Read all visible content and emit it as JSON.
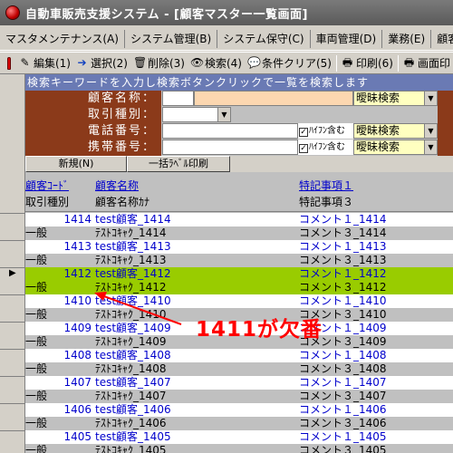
{
  "window": {
    "title": "自動車販売支援システム - [顧客マスター一覧画面]"
  },
  "menubar": {
    "items": [
      "マスタメンテナンス(A)",
      "システム管理(B)",
      "システム保守(C)",
      "車両管理(D)",
      "業務(E)",
      "顧客取引履"
    ]
  },
  "toolbar": {
    "edit": "編集(1)",
    "select": "選択(2)",
    "delete": "削除(3)",
    "search": "検索(4)",
    "clear": "条件クリア(5)",
    "print": "印刷(6)",
    "screen_print": "画面印"
  },
  "search": {
    "hint": "検索キーワードを入力し検索ボタンクリックで一覧を検索します",
    "customer_name_label": "顧客名称：",
    "trade_type_label": "取引種別：",
    "phone_label": "電話番号：",
    "mobile_label": "携帯番号：",
    "hyphen_label": "ﾊｲﾌﾝ含む",
    "fuzzy_label": "曖昧検索"
  },
  "buttons": {
    "new": "新規(N)",
    "bulk_label_print": "一括ﾗﾍﾞﾙ印刷"
  },
  "grid": {
    "headers": {
      "customer_code": "顧客ｺｰﾄﾞ",
      "customer_name": "顧客名称",
      "special1": "特記事項１",
      "trade_type": "取引種別",
      "customer_kana": "顧客名称ｶﾅ",
      "special3": "特記事項３"
    },
    "records": [
      {
        "code": "1414",
        "name": "test顧客_1414",
        "note1": "コメント１_1414",
        "type": "一般",
        "kana": "ﾃｽﾄｺｷｬｸ_1414",
        "note3": "コメント３_1414"
      },
      {
        "code": "1413",
        "name": "test顧客_1413",
        "note1": "コメント１_1413",
        "type": "一般",
        "kana": "ﾃｽﾄｺｷｬｸ_1413",
        "note3": "コメント３_1413"
      },
      {
        "code": "1412",
        "name": "test顧客_1412",
        "note1": "コメント１_1412",
        "type": "一般",
        "kana": "ﾃｽﾄｺｷｬｸ_1412",
        "note3": "コメント３_1412"
      },
      {
        "code": "1410",
        "name": "test顧客_1410",
        "note1": "コメント１_1410",
        "type": "一般",
        "kana": "ﾃｽﾄｺｷｬｸ_1410",
        "note3": "コメント３_1410"
      },
      {
        "code": "1409",
        "name": "test顧客_1409",
        "note1": "コメント１_1409",
        "type": "一般",
        "kana": "ﾃｽﾄｺｷｬｸ_1409",
        "note3": "コメント３_1409"
      },
      {
        "code": "1408",
        "name": "test顧客_1408",
        "note1": "コメント１_1408",
        "type": "一般",
        "kana": "ﾃｽﾄｺｷｬｸ_1408",
        "note3": "コメント３_1408"
      },
      {
        "code": "1407",
        "name": "test顧客_1407",
        "note1": "コメント１_1407",
        "type": "一般",
        "kana": "ﾃｽﾄｺｷｬｸ_1407",
        "note3": "コメント３_1407"
      },
      {
        "code": "1406",
        "name": "test顧客_1406",
        "note1": "コメント１_1406",
        "type": "一般",
        "kana": "ﾃｽﾄｺｷｬｸ_1406",
        "note3": "コメント３_1406"
      },
      {
        "code": "1405",
        "name": "test顧客_1405",
        "note1": "コメント１_1405",
        "type": "一般",
        "kana": "ﾃｽﾄｺｷｬｸ_1405",
        "note3": "コメント３_1405"
      }
    ]
  },
  "annotation": {
    "text": "1411が欠番"
  },
  "colors": {
    "label_bg": "#8b3a1a",
    "selected_row": "#99cc00",
    "hint_bg": "#6a7ab4",
    "annotation": "#ff0000"
  }
}
